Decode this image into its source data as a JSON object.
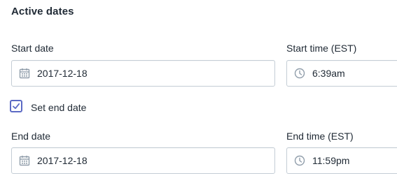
{
  "section": {
    "title": "Active dates"
  },
  "start": {
    "date_label": "Start date",
    "date_value": "2017-12-18",
    "time_label": "Start time (EST)",
    "time_value": "6:39am"
  },
  "end_toggle": {
    "label": "Set end date",
    "checked": true
  },
  "end": {
    "date_label": "End date",
    "date_value": "2017-12-18",
    "time_label": "End time (EST)",
    "time_value": "11:59pm"
  },
  "icons": {
    "date": "calendar-icon",
    "time": "clock-icon",
    "check": "checkmark-icon"
  },
  "colors": {
    "accent": "#5c6ac4",
    "border": "#c4cdd5",
    "icon": "#919eab",
    "text": "#212b36"
  }
}
